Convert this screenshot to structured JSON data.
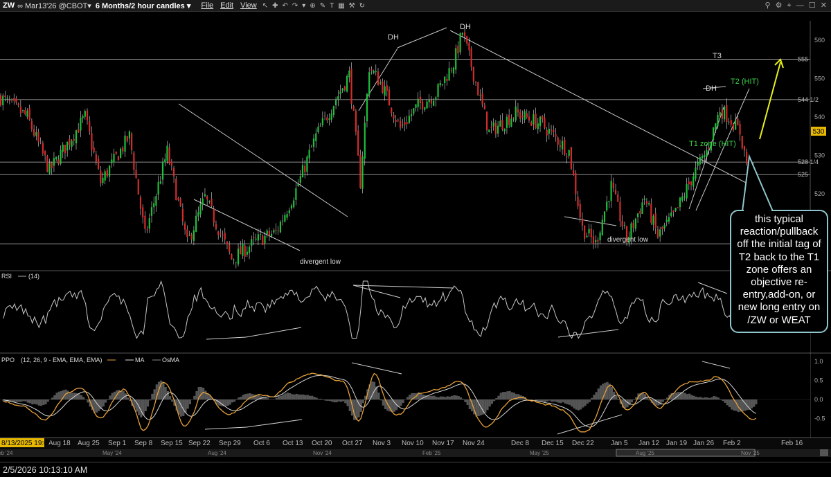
{
  "toolbar": {
    "symbol": "ZW",
    "contract": "∞ Mar13'26 @CBOT▾",
    "timeframe": "6 Months/2 hour candles ▾",
    "menus": [
      "File",
      "Edit",
      "View"
    ]
  },
  "status": {
    "timestamp": "2/5/2026 10:13:10 AM"
  },
  "callout": {
    "text": "this typical reaction/pullback off the initial tag of T2 back to the T1 zone offers an objective re-entry,add-on, or new long entry on /ZW or WEAT"
  },
  "colors": {
    "up": "#1fbf3a",
    "down": "#d42b2b",
    "rsi": "#c8c8c8",
    "ppo": "#e7a23a",
    "ppo_signal": "#d8d8d8",
    "osma": "#555555",
    "arrow": "#e8f01a",
    "t_label": "#3fd24a",
    "callout_border": "#8fc6cc",
    "price_badge": "#e6b800"
  },
  "chart_data": [
    {
      "type": "candlestick",
      "panel": "price",
      "ylim": [
        500,
        565
      ],
      "yticks": [
        "560",
        "550",
        "540",
        "530",
        "520",
        "510"
      ],
      "right_labels": [
        "555",
        "544 1/2",
        "528 1/4",
        "525",
        "507"
      ],
      "last_price_badge": "530",
      "horizontal_levels": [
        555,
        544.5,
        528.25,
        525,
        507
      ],
      "annotations": [
        "DH",
        "DH",
        "DH",
        "T3",
        "T2 (HIT)",
        "T1 zone (HIT)",
        "divergent low",
        "divergent low"
      ],
      "anchors": [
        {
          "x": 0,
          "y": 545
        },
        {
          "x": 12,
          "y": 540
        },
        {
          "x": 22,
          "y": 526
        },
        {
          "x": 38,
          "y": 540
        },
        {
          "x": 45,
          "y": 523
        },
        {
          "x": 58,
          "y": 535
        },
        {
          "x": 65,
          "y": 509
        },
        {
          "x": 75,
          "y": 531
        },
        {
          "x": 84,
          "y": 507
        },
        {
          "x": 92,
          "y": 519
        },
        {
          "x": 104,
          "y": 503
        },
        {
          "x": 116,
          "y": 508
        },
        {
          "x": 124,
          "y": 510
        },
        {
          "x": 133,
          "y": 521
        },
        {
          "x": 142,
          "y": 535
        },
        {
          "x": 157,
          "y": 551
        },
        {
          "x": 162,
          "y": 523
        },
        {
          "x": 166,
          "y": 553
        },
        {
          "x": 172,
          "y": 548
        },
        {
          "x": 180,
          "y": 537
        },
        {
          "x": 188,
          "y": 543
        },
        {
          "x": 196,
          "y": 546
        },
        {
          "x": 204,
          "y": 554
        },
        {
          "x": 208,
          "y": 562
        },
        {
          "x": 214,
          "y": 549
        },
        {
          "x": 220,
          "y": 536
        },
        {
          "x": 232,
          "y": 541
        },
        {
          "x": 244,
          "y": 538
        },
        {
          "x": 256,
          "y": 531
        },
        {
          "x": 262,
          "y": 511
        },
        {
          "x": 268,
          "y": 507
        },
        {
          "x": 275,
          "y": 522
        },
        {
          "x": 282,
          "y": 508
        },
        {
          "x": 290,
          "y": 519
        },
        {
          "x": 296,
          "y": 509
        },
        {
          "x": 304,
          "y": 515
        },
        {
          "x": 312,
          "y": 525
        },
        {
          "x": 318,
          "y": 531
        },
        {
          "x": 324,
          "y": 542
        },
        {
          "x": 328,
          "y": 540
        },
        {
          "x": 333,
          "y": 536
        },
        {
          "x": 336,
          "y": 528
        },
        {
          "x": 339,
          "y": 525
        }
      ]
    },
    {
      "type": "line",
      "panel": "rsi",
      "title": "RSI",
      "params": "(14)",
      "ylim": [
        0,
        100
      ]
    },
    {
      "type": "line",
      "panel": "ppo",
      "title": "PPO",
      "params": "(12, 26, 9 - EMA, EMA, EMA)",
      "legend": [
        "MA",
        "OsMA"
      ],
      "ylim": [
        -1.0,
        1.2
      ],
      "yticks": [
        "1.0",
        "0.5",
        "0.0",
        "-0.5"
      ]
    },
    {
      "type": "axis",
      "panel": "time",
      "date_labels": [
        "Aug 18",
        "Aug 25",
        "Sep 1",
        "Sep 8",
        "Sep 15",
        "Sep 22",
        "Sep 29",
        "Oct 6",
        "Oct 13",
        "Oct 20",
        "Oct 27",
        "Nov 3",
        "Nov 10",
        "Nov 17",
        "Nov 24",
        "Dec 8",
        "Dec 15",
        "Dec 22",
        "Jan 5",
        "Jan 12",
        "Jan 19",
        "Jan 26",
        "Feb 2",
        "Feb 16"
      ],
      "current_date_label": "8/13/2025 19:00",
      "overview_labels": [
        "Feb '24",
        "May '24",
        "Aug '24",
        "Nov '24",
        "Feb '25",
        "May '25",
        "Aug '25",
        "Nov '25"
      ]
    }
  ]
}
